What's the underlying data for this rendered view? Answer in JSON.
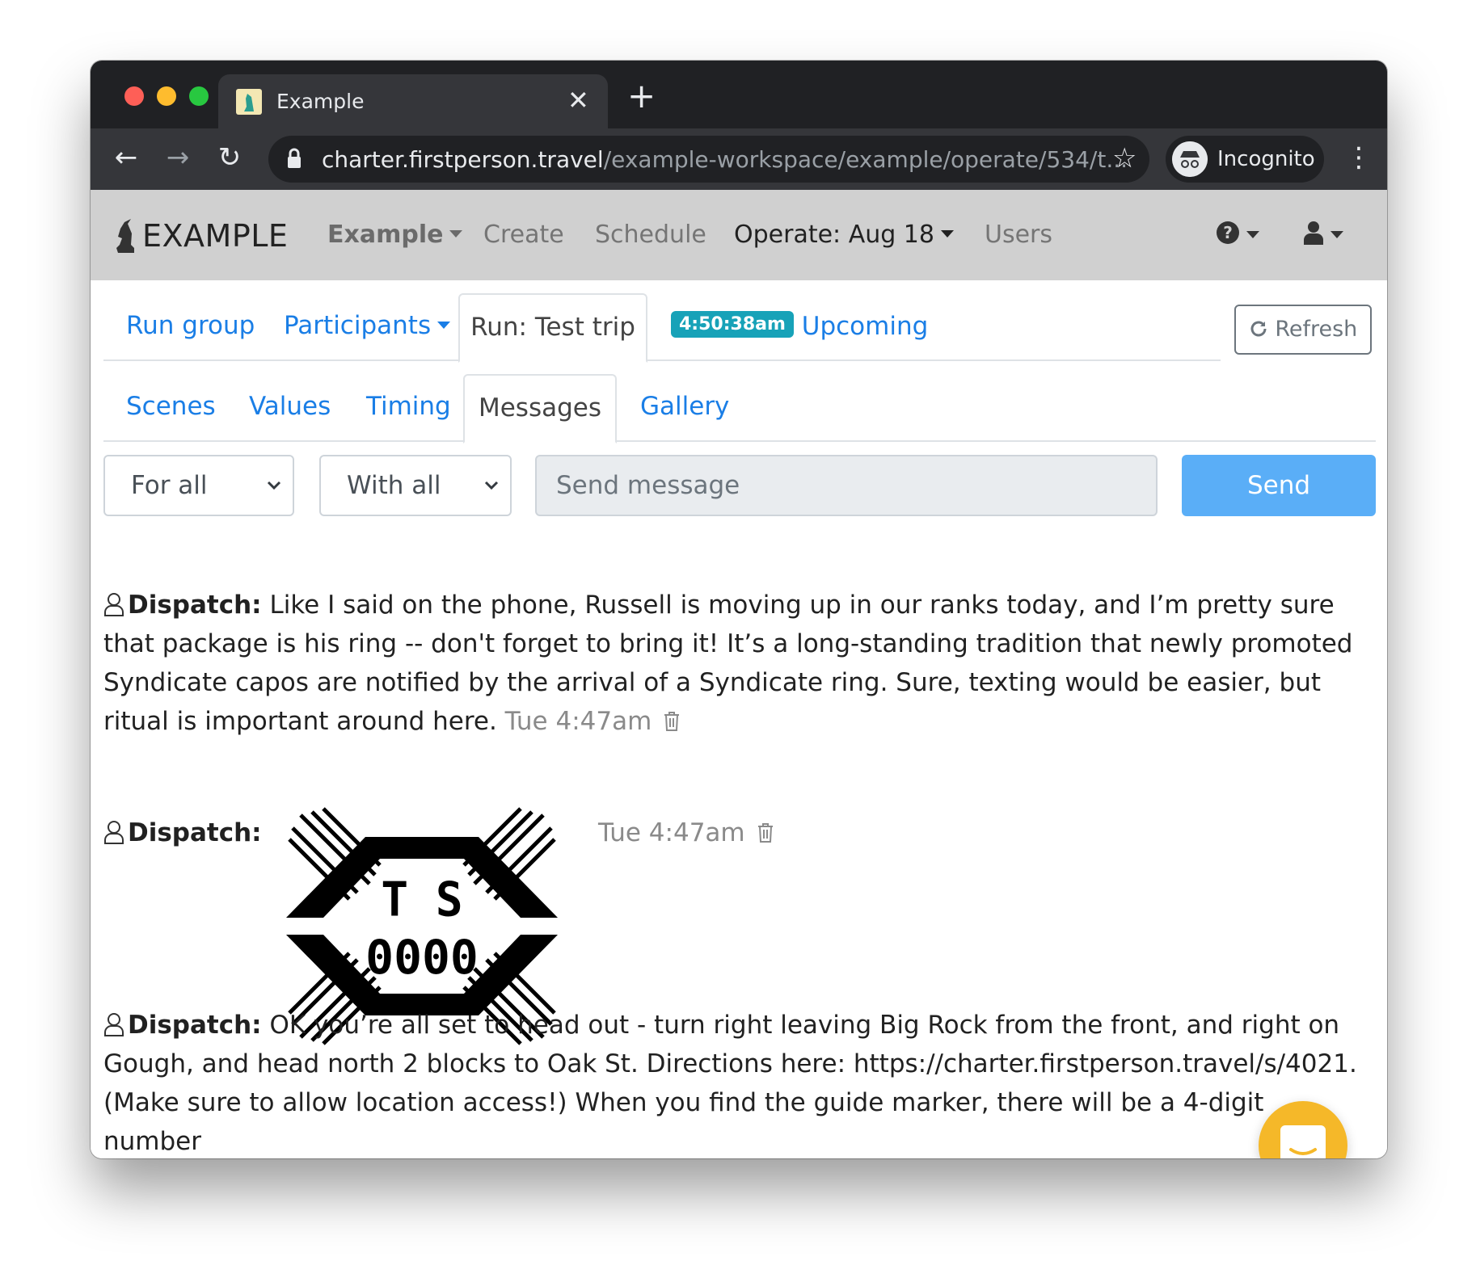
{
  "browser": {
    "tab_title": "Example",
    "url_host": "charter.firstperson.travel",
    "url_path": "/example-workspace/example/operate/534/t...",
    "profile_label": "Incognito"
  },
  "navbar": {
    "brand": "EXAMPLE",
    "workspace": "Example",
    "create": "Create",
    "schedule": "Schedule",
    "operate": "Operate: Aug 18",
    "users": "Users"
  },
  "run_tabs": {
    "run_group": "Run group",
    "participants": "Participants",
    "run": "Run: Test trip",
    "time_badge": "4:50:38am",
    "upcoming": "Upcoming",
    "refresh": "Refresh"
  },
  "section_tabs": [
    "Scenes",
    "Values",
    "Timing",
    "Messages",
    "Gallery"
  ],
  "composer": {
    "for_select": "For all",
    "with_select": "With all",
    "message_placeholder": "Send message",
    "send_label": "Send"
  },
  "messages": [
    {
      "sender": "Dispatch:",
      "text": "Like I said on the phone, Russell is moving up in our ranks today, and I’m pretty sure that package is his ring -- don't forget to bring it! It’s a long-standing tradition that newly promoted Syndicate capos are notified by the arrival of a Syndicate ring. Sure, texting would be easier, but ritual is important around here.",
      "time": "Tue 4:47am"
    },
    {
      "sender": "Dispatch:",
      "image_line1": "T S",
      "image_line2": "0000",
      "time": "Tue 4:47am"
    },
    {
      "sender": "Dispatch:",
      "text": "OK you’re all set to head out - turn right leaving Big Rock from the front, and right on Gough, and head north 2 blocks to Oak St. Directions here: https://charter.firstperson.travel/s/4021. (Make sure to allow location access!) When you find the guide marker, there will be a 4-digit number"
    }
  ],
  "colors": {
    "link": "#1a7ee6",
    "send_button": "#5aaef7",
    "badge": "#17a2b8",
    "intercom": "#f5b829"
  }
}
